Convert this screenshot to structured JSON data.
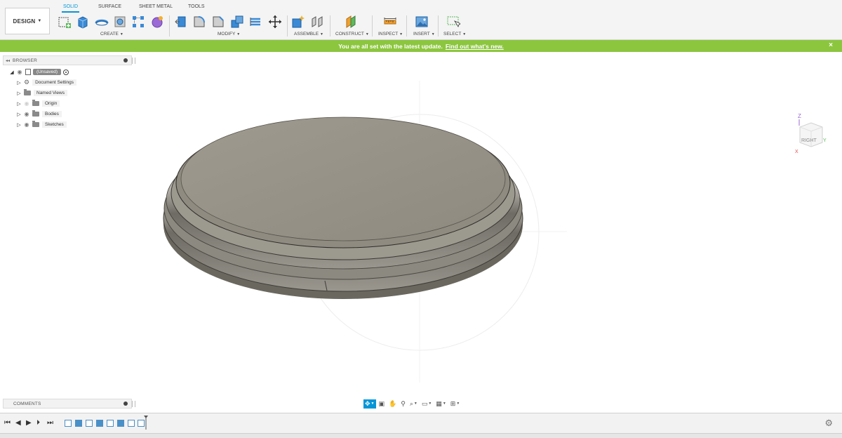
{
  "workspace": {
    "label": "DESIGN"
  },
  "tabs": [
    {
      "label": "SOLID",
      "active": true
    },
    {
      "label": "SURFACE",
      "active": false
    },
    {
      "label": "SHEET METAL",
      "active": false
    },
    {
      "label": "TOOLS",
      "active": false
    }
  ],
  "groups": {
    "create": "CREATE",
    "modify": "MODIFY",
    "assemble": "ASSEMBLE",
    "construct": "CONSTRUCT",
    "inspect": "INSPECT",
    "insert": "INSERT",
    "select": "SELECT"
  },
  "banner": {
    "message": "You are all set with the latest update.",
    "link": "Find out what's new.",
    "close_label": "×",
    "color": "#8cc63f"
  },
  "browser": {
    "title": "BROWSER",
    "root": "(Unsaved)",
    "items": [
      {
        "label": "Document Settings",
        "icon": "gear-icon"
      },
      {
        "label": "Named Views",
        "icon": "folder-icon"
      },
      {
        "label": "Origin",
        "icon": "folder-icon"
      },
      {
        "label": "Bodies",
        "icon": "folder-icon"
      },
      {
        "label": "Sketches",
        "icon": "folder-icon"
      }
    ]
  },
  "comments": {
    "title": "COMMENTS"
  },
  "viewcube": {
    "face": "RIGHT",
    "axis_z": "Z",
    "axis_y": "Y",
    "axis_x": "X"
  },
  "accent_color": "#0696d7"
}
